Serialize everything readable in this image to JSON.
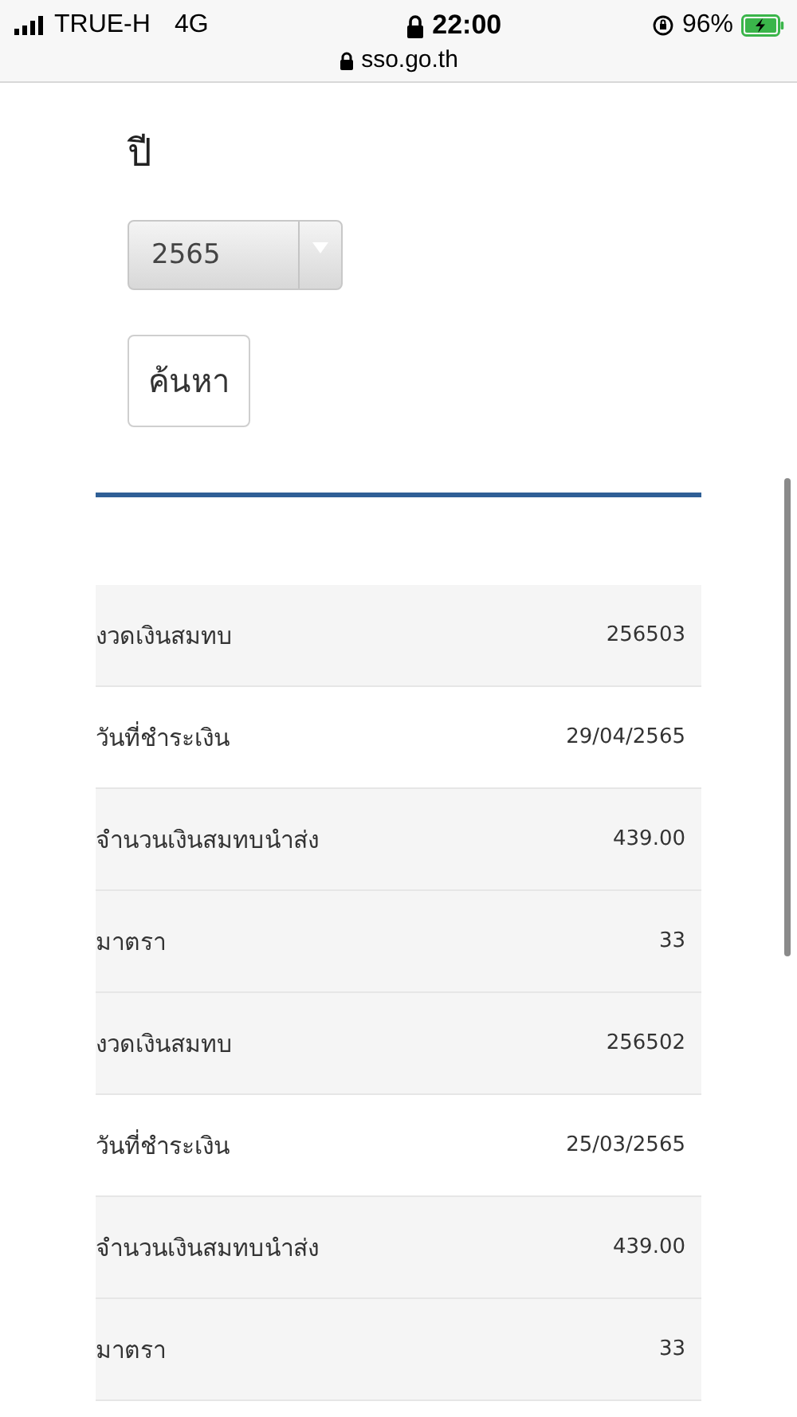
{
  "status_bar": {
    "carrier": "TRUE-H",
    "network": "4G",
    "time": "22:00",
    "battery": "96%"
  },
  "address_bar": {
    "url": "sso.go.th"
  },
  "year_filter": {
    "label": "ปี",
    "value": "2565"
  },
  "search_button": {
    "label": "ค้นหา"
  },
  "records": [
    {
      "rows": [
        {
          "label": "งวดเงินสมทบ",
          "value": "256503"
        },
        {
          "label": "วันที่ชำระเงิน",
          "value": "29/04/2565"
        },
        {
          "label": "จำนวนเงินสมทบนำส่ง",
          "value": "439.00"
        },
        {
          "label": "มาตรา",
          "value": "33"
        }
      ]
    },
    {
      "rows": [
        {
          "label": "งวดเงินสมทบ",
          "value": "256502"
        },
        {
          "label": "วันที่ชำระเงิน",
          "value": "25/03/2565"
        },
        {
          "label": "จำนวนเงินสมทบนำส่ง",
          "value": "439.00"
        },
        {
          "label": "มาตรา",
          "value": "33"
        }
      ]
    }
  ]
}
